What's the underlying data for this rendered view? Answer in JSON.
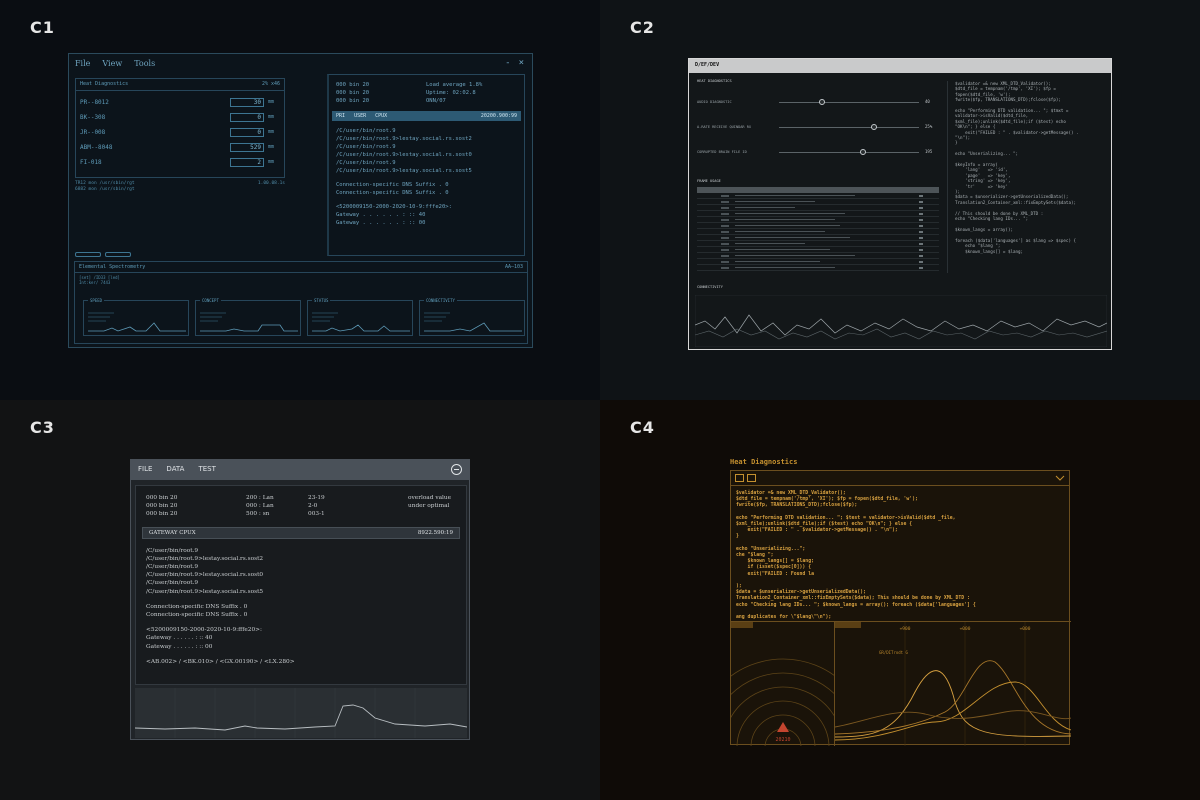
{
  "quadrants": [
    {
      "label": "C1"
    },
    {
      "label": "C2"
    },
    {
      "label": "C3"
    },
    {
      "label": "C4"
    }
  ],
  "c1": {
    "menu": [
      "File",
      "View",
      "Tools"
    ],
    "controls": [
      "-",
      "×"
    ],
    "panel_title": "Heat Diagnostics",
    "panel_meta": "2% x46",
    "fields": [
      {
        "label": "PR--8012",
        "value": "30",
        "unit": "mm"
      },
      {
        "label": "BK--308",
        "value": "0",
        "unit": "mm"
      },
      {
        "label": "JR--008",
        "value": "0",
        "unit": "mm"
      },
      {
        "label": "ABM--8048",
        "value": "529",
        "unit": "mm"
      },
      {
        "label": "FI-018",
        "value": "2",
        "unit": "mm"
      }
    ],
    "footer_lines": [
      "TR12 mon  /usr/sbin/rgt",
      "6882 mon  /usr/sbin/rgt"
    ],
    "footer_right": "1.00.08.1s",
    "stats": [
      [
        "000  bin  20",
        "Load average 1.8%"
      ],
      [
        "000  bin  20",
        "Uptime: 02:02.8"
      ],
      [
        "000  bin  20",
        "ONN/07"
      ]
    ],
    "process_bar": {
      "cols": [
        "PRI",
        "USER",
        "CPUX"
      ],
      "right": "20200.900:99"
    },
    "paths": [
      "/C/user/bin/root.9",
      "/C/user/bin/root.9>lestay.social.rs.sost2",
      "/C/user/bin/root.9",
      "/C/user/bin/root.9>lestay.social.rs.sost0",
      "/C/user/bin/root.9",
      "/C/user/bin/root.9>lestay.social.rs.sost5"
    ],
    "dns": [
      "Connection-specific DNS Suffix  .  0",
      "Connection-specific DNS Suffix  .  0"
    ],
    "ipv6": "<5200009150-2000-2020-10-9:fffe20>:",
    "gateways": [
      "Gateway . . . . . . : :: 40",
      "Gateway . . . . . . : :: 00"
    ],
    "bottom_title": "Elemental Spectrometry",
    "bottom_meta": "AA—103",
    "bottom_sub": [
      "[set] /ID33 [led]",
      "Int:ker/ 7443"
    ],
    "minis": [
      "SPEED",
      "CONCEPT",
      "STATUS",
      "CONNECTIVITY"
    ]
  },
  "c2": {
    "title": "D/EF/DEV",
    "section": "HEAT DIAGNOSTICS",
    "sliders": [
      {
        "label": "AUDIO DIAGNOSTIC",
        "value": "40",
        "pos": 0.3
      },
      {
        "label": "A-RATE RECEIVE QUINDAR RX",
        "value": "25%",
        "pos": 0.68
      },
      {
        "label": "CORRUPTED BRAIN FILE ID",
        "value": "195",
        "pos": 0.6
      }
    ],
    "table_title": "FRAME USAGE",
    "connectivity": "CONNECTIVITY",
    "code": [
      "$validator =& new XML_DTD_Validator();",
      "$dtd_file = tempnam('/tmp', 'XI'); $fp =",
      "fopen($dtd_file, 'w');",
      "fwrite($fp, TRANSLATIONS_DTD);fclose($fp);",
      "",
      "echo \"Performing DTD validation... \"; $tmxt =",
      "validator->isValid($dtd_file,",
      "$xml_file);unlink($dtd_file);if ($test) echo",
      "\"OK\\n\"; } else {",
      "    exit(\"FAILED : \" . $validator->getMessage() .",
      "\"\\n\");",
      "}",
      "",
      "echo \"Unserializing... \";",
      "",
      "$keyInfo = array(",
      "    'lang'   => 'id',",
      "    'page'   => 'key',",
      "    'string' => 'key',",
      "    'tr'     => 'key'",
      ");",
      "$data = $unserializer->getUnserializedData();",
      "Translation2_Container_xml::fixEmptySets($data);",
      "",
      "// This should be done by XML_DTD :",
      "echo \"Checking lang IDs... \";",
      "",
      "$known_langs = array();",
      "",
      "foreach ($data['languages'] as $lang => $spec) {",
      "    echo \"$lang \";",
      "    $known_langs[] = $lang;"
    ]
  },
  "c3": {
    "menu": [
      "FILE",
      "DATA",
      "TEST"
    ],
    "grid": [
      [
        "000  bin  20",
        "200  : Lan",
        "23-19",
        "overload value"
      ],
      [
        "000  bin  20",
        "000  : Lan",
        "2-0",
        "under optimal"
      ],
      [
        "000  bin  20",
        "500  : sn",
        "003-1",
        ""
      ]
    ],
    "bar": {
      "left": "GATEWAY    CPUX",
      "right": "8922.590:19"
    },
    "paths": [
      "/C/user/bin/root.9",
      "/C/user/bin/root.9>lestay.social.rs.sost2",
      "/C/user/bin/root.9",
      "/C/user/bin/root.9>lestay.social.rs.sost0",
      "/C/user/bin/root.9",
      "/C/user/bin/root.9>lestay.social.rs.sost5"
    ],
    "dns": [
      "Connection-specific DNS Suffix  .  0",
      "Connection-specific DNS Suffix  .  0"
    ],
    "ipv6": "<5200009150-2000-2020-10-9:fffe20>:",
    "gateways": [
      "Gateway . . . . . . : :: 40",
      "Gateway . . . . . . : :: 00"
    ],
    "coords": "<AB.002> / <BK.010> / <GX.00190> / <LX.280>"
  },
  "c4": {
    "title": "Heat Diagnostics",
    "code": [
      "$validator =& new XML_DTD_Validator();",
      "$dtd_file = tempnam('/tmp', 'XI'); $fp = fopen($dtd_file, 'w');",
      "fwrite($fp, TRANSLATIONS_DTD);fclose($fp);",
      "",
      "echo \"Performing DTD validation... \"; $test = validator->isValid($dtd _file,",
      "$xml_file);unlink($dtd_file);if ($test) echo \"OK\\n\"; } else {",
      "    exit(\"FAILED : \" . $validator->getMessage() . \"\\n\");",
      "}",
      "",
      "echo \"Unserializing...\";",
      "che \"$lang \";",
      "    $known_langs[] = $lang;",
      "    if (isset($spec[0])) {",
      "    exit(\"FAILED : Found la",
      "",
      ");",
      "$data = $unserializer->getUnserializedData();",
      "Translation2_Container_xml::fixEmptySets($data); This should be done by XML_DTD :",
      "echo \"Checking lang IDs... \"; $known_langs = array(); foreach ($data['languages'] {",
      "",
      "ang duplicates for \\\"$lang\\\"\\n\");"
    ],
    "radar_value": "20210",
    "plot_ticks": [
      "+900",
      "+000",
      "+000"
    ],
    "plot_note": "GR/DITrodt  G"
  }
}
